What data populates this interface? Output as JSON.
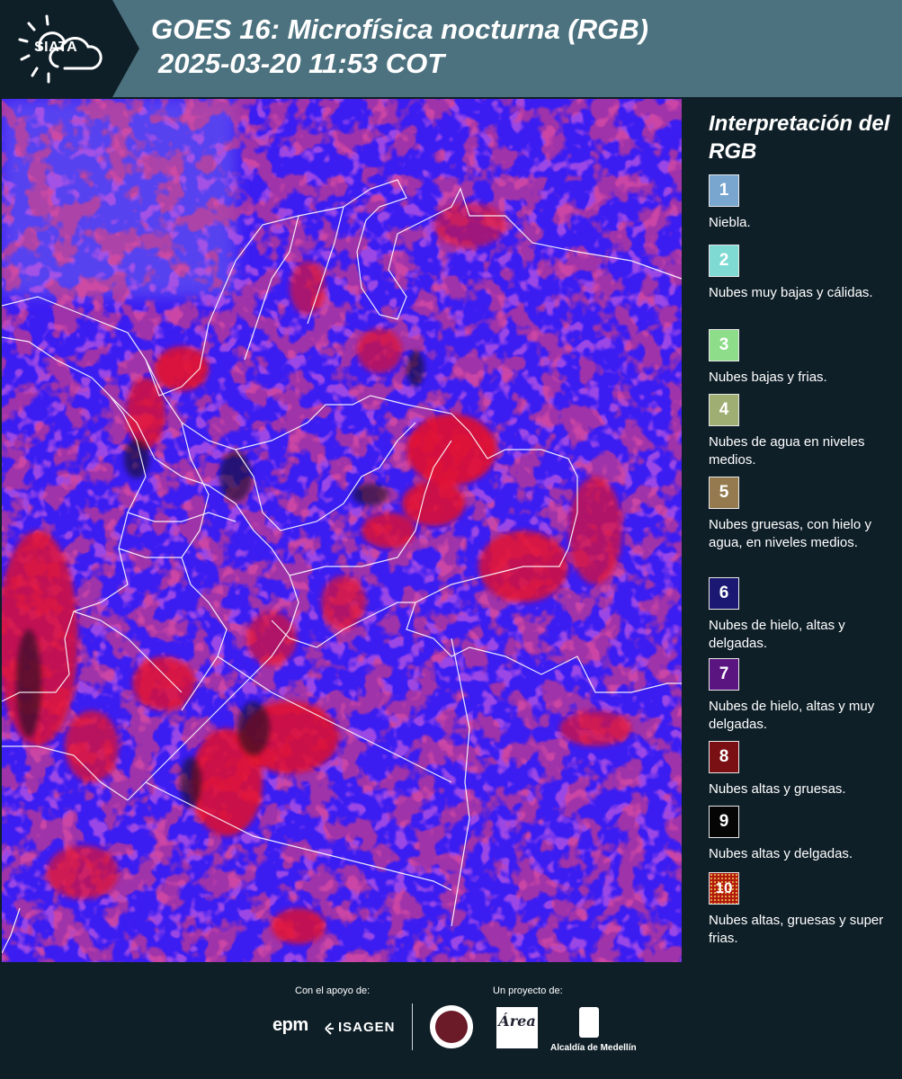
{
  "header": {
    "logo_text": "SIATA",
    "title_line1": "GOES 16: Microfísica nocturna (RGB)",
    "title_line2": "2025-03-20 11:53 COT",
    "background_color": "#4d727f"
  },
  "legend": {
    "title": "Interpretación del RGB",
    "items": [
      {
        "number": "1",
        "label": "Niebla.",
        "color": "#78a6cf"
      },
      {
        "number": "2",
        "label": "Nubes muy bajas y cálidas.",
        "color": "#7fdad4"
      },
      {
        "number": "3",
        "label": "Nubes bajas y frias.",
        "color": "#8ddd8a"
      },
      {
        "number": "4",
        "label": "Nubes de agua en niveles medios.",
        "color": "#9fae72"
      },
      {
        "number": "5",
        "label": "Nubes gruesas, con hielo y agua, en niveles medios.",
        "color": "#947a4e"
      },
      {
        "number": "6",
        "label": "Nubes de hielo, altas y delgadas.",
        "color": "#1a1872"
      },
      {
        "number": "7",
        "label": "Nubes de hielo, altas y muy delgadas.",
        "color": "#5a1580"
      },
      {
        "number": "8",
        "label": "Nubes altas y gruesas.",
        "color": "#7a0f14"
      },
      {
        "number": "9",
        "label": "Nubes altas y delgadas.",
        "color": "#050505"
      },
      {
        "number": "10",
        "label": "Nubes altas, gruesas y super frias.",
        "color": "#b31a0e"
      }
    ]
  },
  "footer": {
    "support_label": "Con el apoyo de:",
    "project_label": "Un proyecto de:",
    "sponsor_1": "epm",
    "sponsor_2": "ISAGEN",
    "partner_1": "Área Metropolitana Valle de Aburrá",
    "partner_2": "Alcaldía de Medellín"
  },
  "map": {
    "background_color": "#3a1cf0",
    "cloud_color": "#e0102a",
    "border_color": "#ffffff"
  }
}
